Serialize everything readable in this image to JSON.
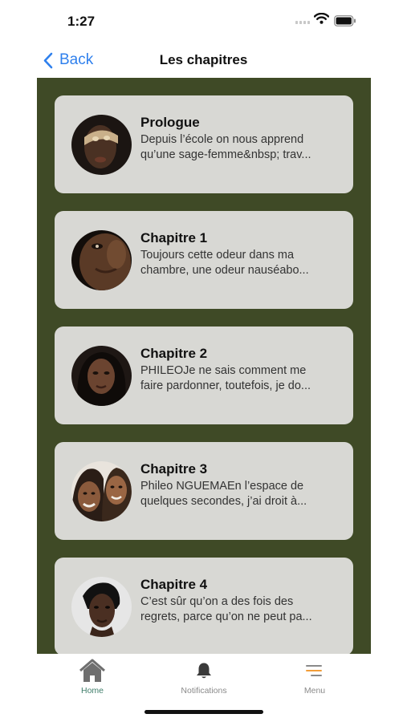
{
  "status_bar": {
    "time": "1:27"
  },
  "nav": {
    "back_label": "Back",
    "title": "Les chapitres"
  },
  "chapters": [
    {
      "title": "Prologue",
      "excerpt": " Depuis l’école on nous apprend\nqu’une sage-femme&nbsp; trav..."
    },
    {
      "title": "Chapitre 1",
      "excerpt": " Toujours cette odeur dans ma\nchambre, une odeur nauséabo..."
    },
    {
      "title": "Chapitre 2",
      "excerpt": " PHILEOJe ne sais comment me\nfaire pardonner, toutefois, je do..."
    },
    {
      "title": "Chapitre 3",
      "excerpt": " Phileo NGUEMAEn l’espace de\nquelques secondes, j’ai droit à..."
    },
    {
      "title": "Chapitre 4",
      "excerpt": " C’est sûr qu’on a des fois des\nregrets, parce qu’on ne peut pa..."
    }
  ],
  "tabs": {
    "home": "Home",
    "notifications": "Notifications",
    "menu": "Menu"
  },
  "colors": {
    "content_bg": "#3f4a26",
    "card_bg": "#d8d8d4",
    "accent": "#2f80ed",
    "home_active": "#3f7d6a"
  }
}
